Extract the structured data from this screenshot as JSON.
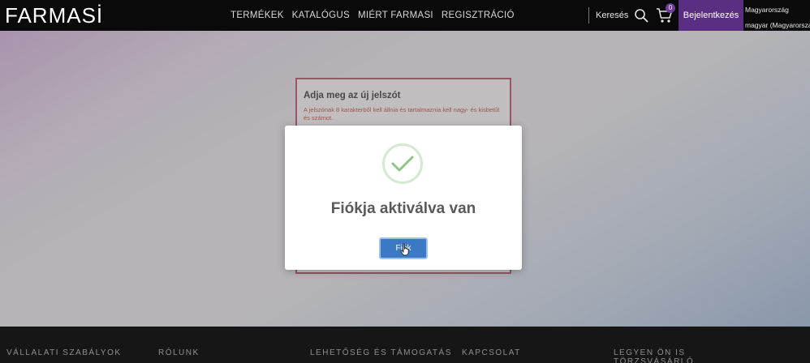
{
  "header": {
    "logo": "FARMASİ",
    "nav": [
      "TERMÉKEK",
      "KATALÓGUS",
      "MIÉRT FARMASI",
      "REGISZTRÁCIÓ"
    ],
    "search_label": "Keresés",
    "search_icon": "search-icon",
    "cart_icon": "cart-icon",
    "cart_count": "0",
    "login_label": "Bejelentkezés",
    "region_country": "Magyarország",
    "region_language": "magyar (Magyarország)"
  },
  "form_card": {
    "title": "Adja meg az új jelszót",
    "hint": "A jelszónak 8 karakterből kell állnia és tartalmaznia kell nagy- és kisbetűt és számot."
  },
  "modal": {
    "icon": "success-check-icon",
    "title": "Fiókja aktiválva van",
    "button_label": "Fiók"
  },
  "footer": {
    "items": [
      "VÁLLALATI SZABÁLYOK",
      "RÓLUNK",
      "LEHETŐSÉG ÉS TÁMOGATÁS",
      "KAPCSOLAT",
      "LEGYEN ÖN IS TÖRZSVÁSÁRLÓ (SZPONZOR)"
    ]
  },
  "colors": {
    "brand_purple": "#5a2e82",
    "button_blue": "#3b79c4",
    "success_green": "#8cc783",
    "card_border": "#b23a55"
  }
}
